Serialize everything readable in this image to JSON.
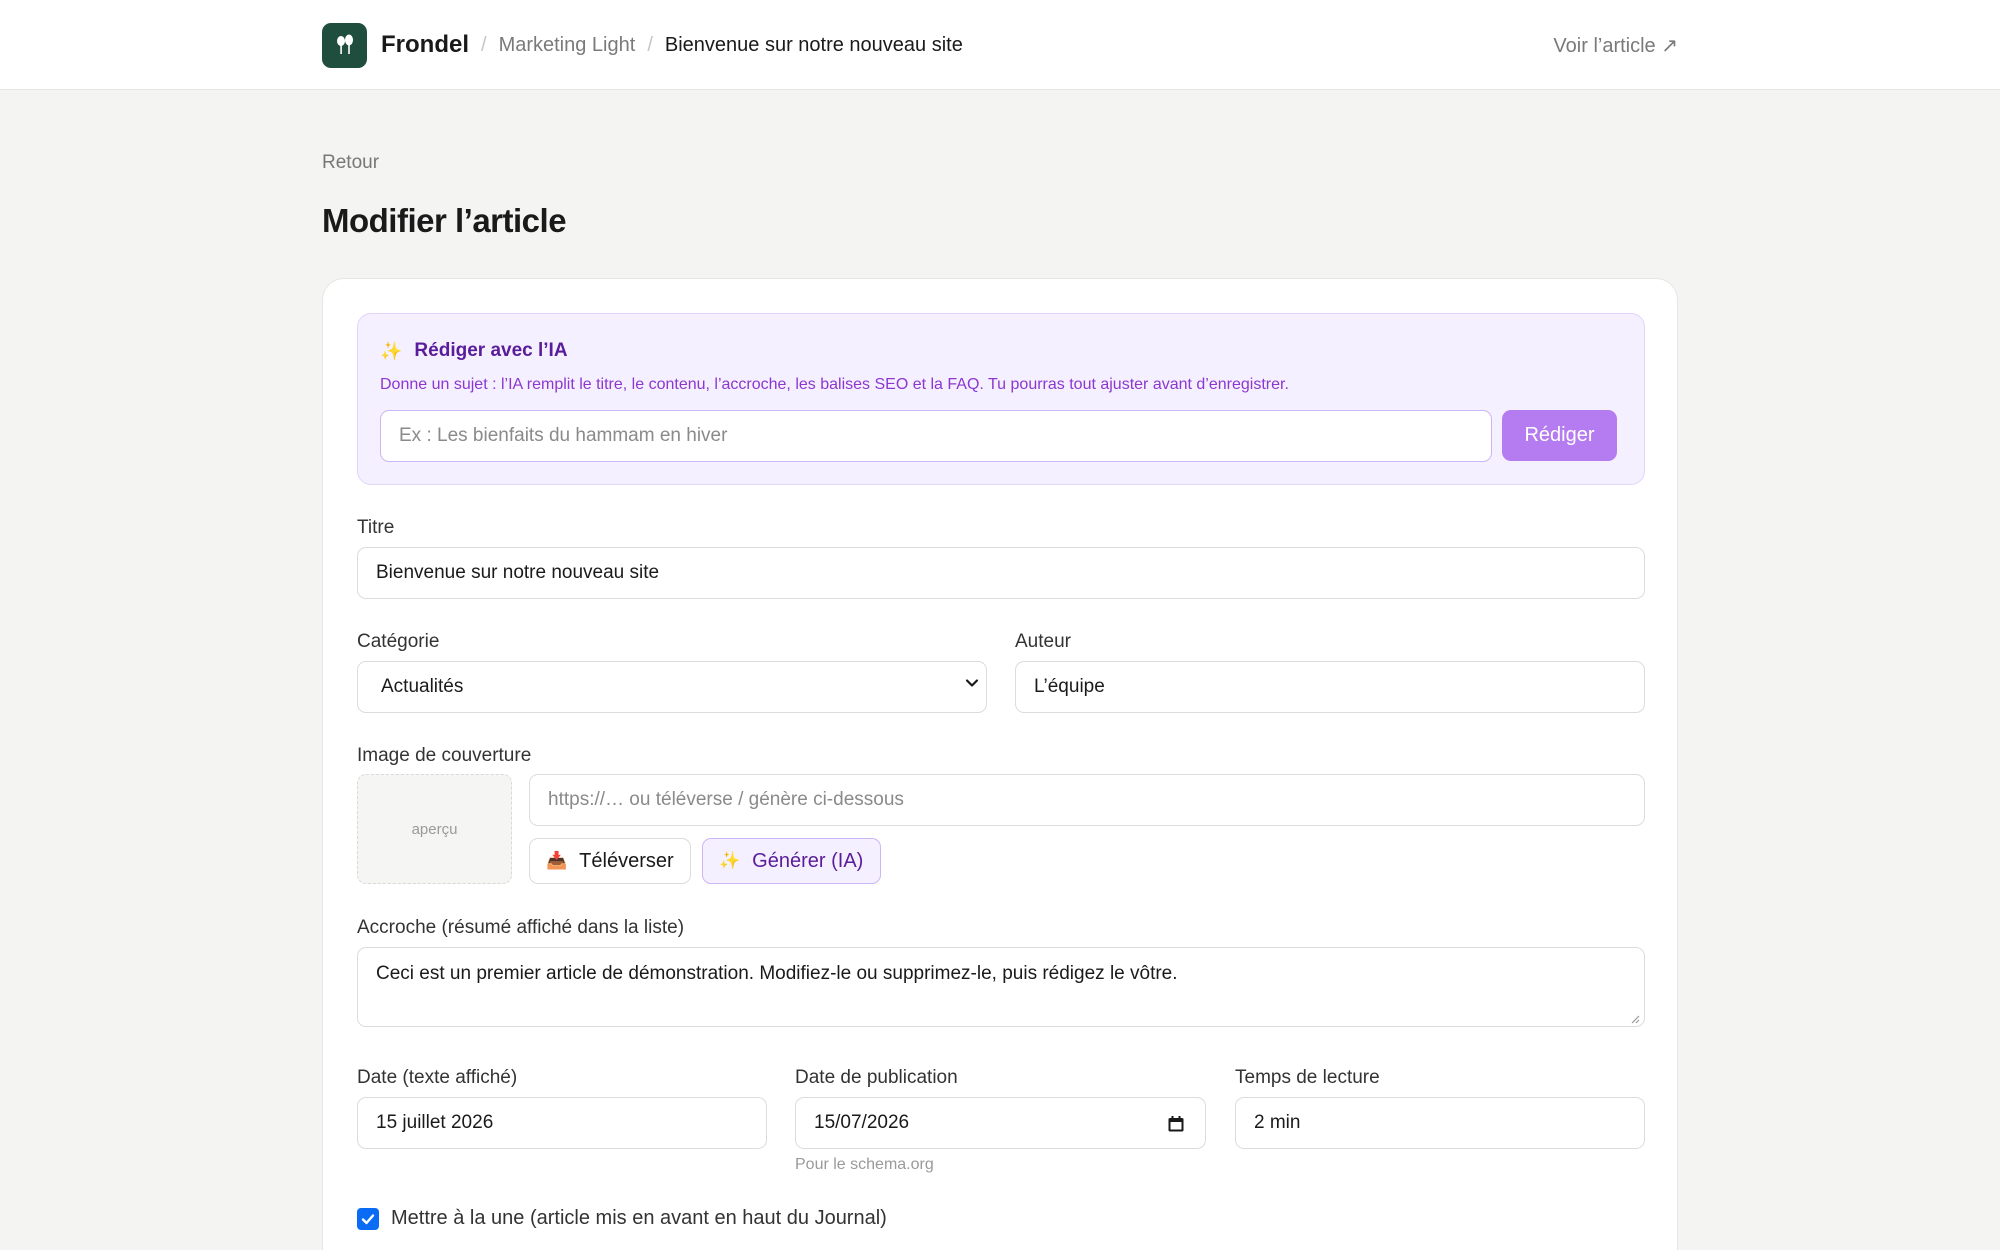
{
  "header": {
    "brand": "Frondel",
    "breadcrumb": [
      "Marketing Light",
      "Bienvenue sur notre nouveau site"
    ],
    "separator": "/",
    "view_link": "Voir l’article ↗",
    "logo_color": "#1f4d3e"
  },
  "page": {
    "back": "Retour",
    "title": "Modifier l’article"
  },
  "ai": {
    "icon": "sparkles-icon",
    "title": "Rédiger avec l’IA",
    "description": "Donne un sujet : l’IA remplit le titre, le contenu, l’accroche, les balises SEO et la FAQ. Tu pourras tout ajuster avant d’enregistrer.",
    "placeholder": "Ex : Les bienfaits du hammam en hiver",
    "value": "",
    "button": "Rédiger",
    "accent": "#b57bf0"
  },
  "form": {
    "title_label": "Titre",
    "title_value": "Bienvenue sur notre nouveau site",
    "category_label": "Catégorie",
    "category_value": "Actualités",
    "author_label": "Auteur",
    "author_value": "L’équipe",
    "cover_label": "Image de couverture",
    "cover_preview": "aperçu",
    "cover_placeholder": "https://… ou téléverse / génère ci-dessous",
    "cover_value": "",
    "upload_button": "Téléverser",
    "upload_icon": "inbox-tray-icon",
    "generate_button": "Générer (IA)",
    "generate_icon": "sparkles-icon",
    "excerpt_label": "Accroche (résumé affiché dans la liste)",
    "excerpt_value": "Ceci est un premier article de démonstration. Modifiez-le ou supprimez-le, puis rédigez le vôtre.",
    "date_text_label": "Date (texte affiché)",
    "date_text_value": "15 juillet 2026",
    "pub_date_label": "Date de publication",
    "pub_date_value": "15/07/2026",
    "pub_date_hint": "Pour le schema.org",
    "reading_label": "Temps de lecture",
    "reading_value": "2 min",
    "featured_label": "Mettre à la une (article mis en avant en haut du Journal)",
    "featured_checked": true,
    "checkbox_color": "#0a6cf5"
  }
}
